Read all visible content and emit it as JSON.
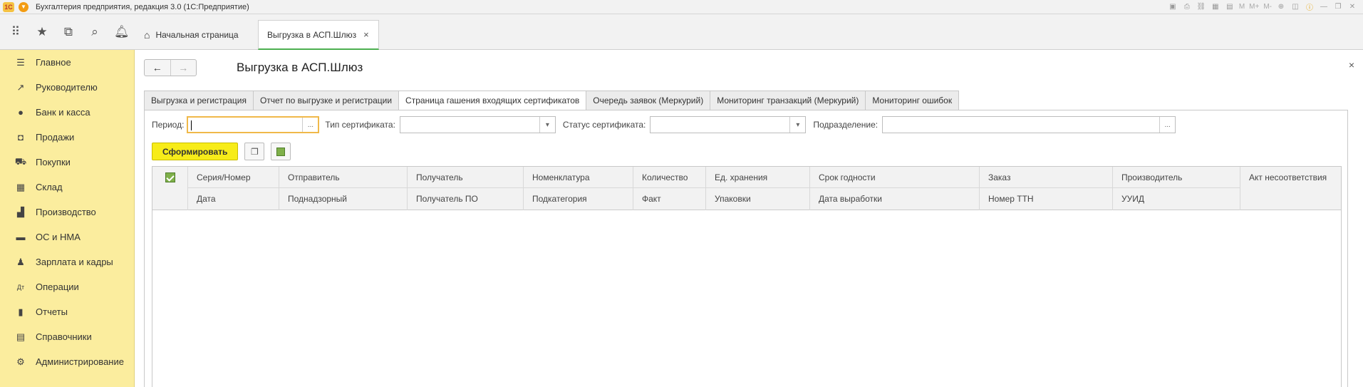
{
  "titlebar": {
    "logo": "1С",
    "app_title": "Бухгалтерия предприятия, редакция 3.0  (1С:Предприятие)",
    "tools": [
      "M",
      "M+",
      "M-"
    ]
  },
  "sectionbar": {
    "home_tab": "Начальная страница",
    "active_tab": "Выгрузка в АСП.Шлюз"
  },
  "sidebar": {
    "items": [
      {
        "label": "Главное",
        "icon": "menu-icon"
      },
      {
        "label": "Руководителю",
        "icon": "trend-icon"
      },
      {
        "label": "Банк и касса",
        "icon": "coin-icon"
      },
      {
        "label": "Продажи",
        "icon": "bag-icon"
      },
      {
        "label": "Покупки",
        "icon": "cart-icon"
      },
      {
        "label": "Склад",
        "icon": "warehouse-icon"
      },
      {
        "label": "Производство",
        "icon": "factory-icon"
      },
      {
        "label": "ОС и НМА",
        "icon": "truck-icon"
      },
      {
        "label": "Зарплата и кадры",
        "icon": "person-icon"
      },
      {
        "label": "Операции",
        "icon": "operations-icon"
      },
      {
        "label": "Отчеты",
        "icon": "chart-icon"
      },
      {
        "label": "Справочники",
        "icon": "book-icon"
      },
      {
        "label": "Администрирование",
        "icon": "gear-icon"
      }
    ]
  },
  "form": {
    "title": "Выгрузка в АСП.Шлюз",
    "tabs": [
      "Выгрузка и регистрация",
      "Отчет по выгрузке и регистрации",
      "Страница гашения входящих сертификатов",
      "Очередь заявок (Меркурий)",
      "Мониторинг транзакций (Меркурий)",
      "Мониторинг ошибок"
    ],
    "active_tab_index": 2,
    "filters": {
      "period_label": "Период:",
      "period_value": "",
      "cert_type_label": "Тип сертификата:",
      "cert_type_value": "",
      "cert_status_label": "Статус сертификата:",
      "cert_status_value": "",
      "division_label": "Подразделение:",
      "division_value": "",
      "ellipsis": "...",
      "dropdown": "▾"
    },
    "actions": {
      "generate": "Сформировать"
    },
    "columns": [
      {
        "top": "Серия/Номер",
        "bottom": "Дата"
      },
      {
        "top": "Отправитель",
        "bottom": "Поднадзорный"
      },
      {
        "top": "Получатель",
        "bottom": "Получатель ПО"
      },
      {
        "top": "Номенклатура",
        "bottom": "Подкатегория"
      },
      {
        "top": "Количество",
        "bottom": "Факт"
      },
      {
        "top": "Ед. хранения",
        "bottom": "Упаковки"
      },
      {
        "top": "Срок годности",
        "bottom": "Дата выработки"
      },
      {
        "top": "Заказ",
        "bottom": "Номер ТТН"
      },
      {
        "top": "Производитель",
        "bottom": "УУИД"
      },
      {
        "top": "Акт несоответствия",
        "bottom": ""
      }
    ]
  }
}
